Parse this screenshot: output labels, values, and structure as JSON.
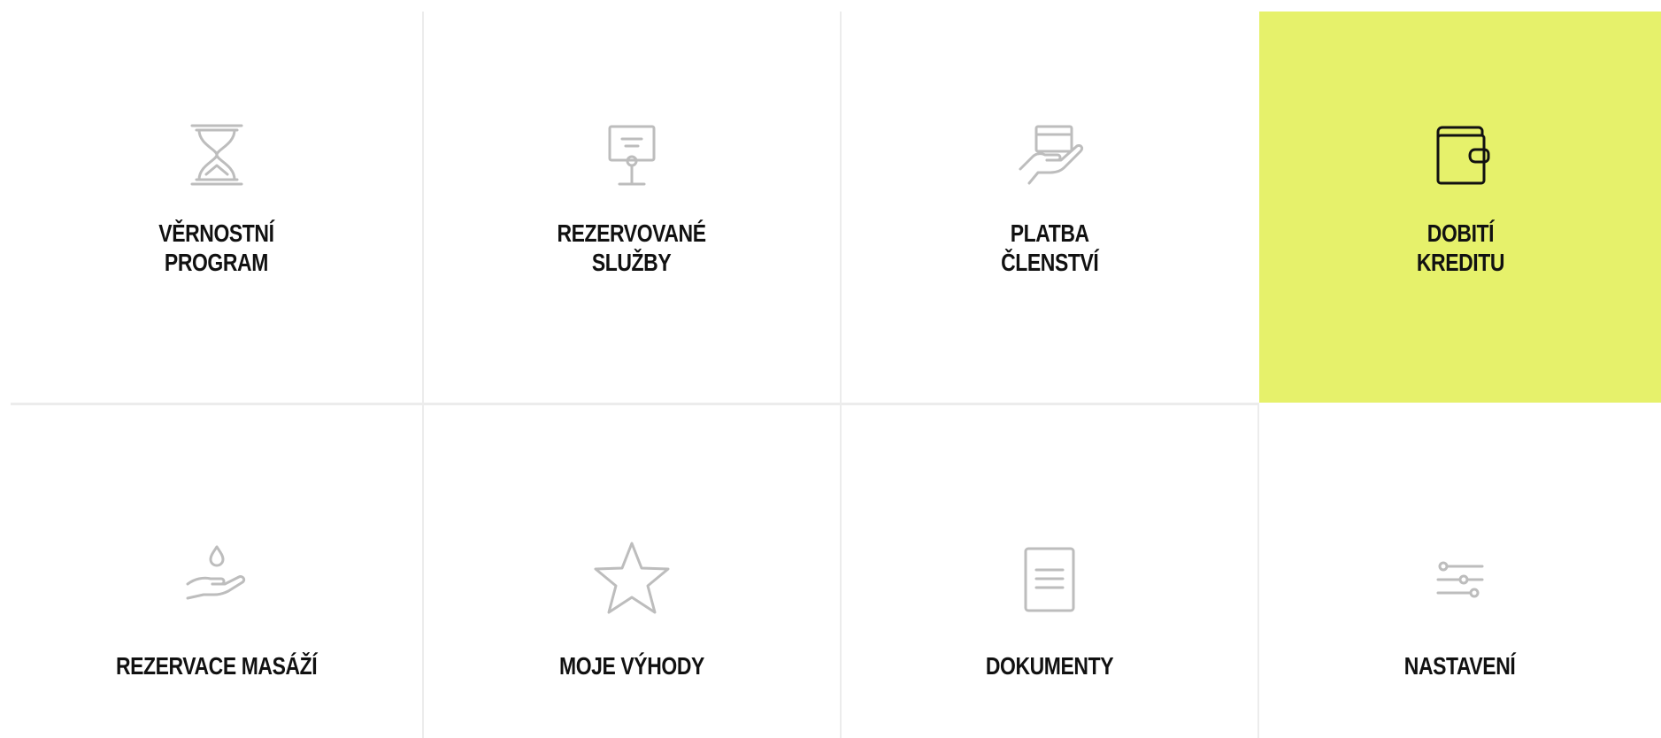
{
  "menu": {
    "tiles": [
      {
        "label_line1": "VĚRNOSTNÍ",
        "label_line2": "PROGRAM",
        "icon": "hourglass-icon"
      },
      {
        "label_line1": "REZERVOVANÉ",
        "label_line2": "SLUŽBY",
        "icon": "reserved-sign-icon"
      },
      {
        "label_line1": "PLATBA",
        "label_line2": "ČLENSTVÍ",
        "icon": "card-in-hand-icon"
      },
      {
        "label_line1": "DOBITÍ",
        "label_line2": "KREDITU",
        "icon": "wallet-icon",
        "active": true
      },
      {
        "label_line1": "REZERVACE MASÁŽÍ",
        "icon": "drop-in-hand-icon"
      },
      {
        "label_line1": "MOJE VÝHODY",
        "icon": "star-icon"
      },
      {
        "label_line1": "DOKUMENTY",
        "icon": "document-icon"
      },
      {
        "label_line1": "NASTAVENÍ",
        "icon": "sliders-icon"
      }
    ],
    "active_color": "#e6f16b",
    "icon_color": "#bdbdbd",
    "text_color": "#111111"
  }
}
